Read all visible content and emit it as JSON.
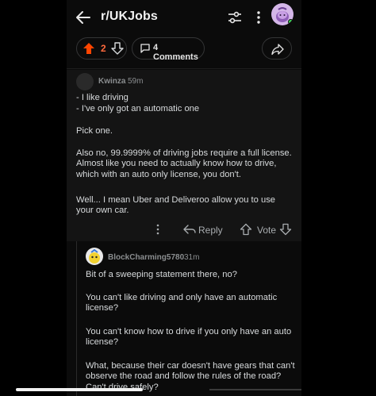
{
  "header": {
    "title": "r/UKJobs",
    "icons": {
      "back": "arrow-left-icon",
      "filter": "sliders-icon",
      "more": "more-vertical-icon"
    }
  },
  "actions": {
    "vote_count": "2",
    "comments_label": "4 Comments",
    "colors": {
      "upvoted": "#ff4500"
    }
  },
  "comment1": {
    "username": "Kwinza",
    "time": "59m",
    "lines": [
      "- I like driving",
      "- I've only got an automatic one"
    ],
    "paragraphs": [
      "Pick one.",
      "Also no, 99.9999% of driving jobs require a full license. Almost like you need to actually know how to drive, which with an auto only license, you don't.",
      "Well... I mean Uber and Deliveroo allow you to use your own car."
    ],
    "reply_label": "Reply",
    "vote_label": "Vote"
  },
  "comment2": {
    "username": "BlockCharming5780",
    "time": "31m",
    "paragraphs": [
      "Bit of a sweeping statement there, no?",
      "You can't like driving and only have an automatic license?",
      "You can't know how to drive if you only have an auto license?",
      "What, because their car doesn't have gears that can't observe the road and follow the rules of the road? Can't drive safely?"
    ]
  }
}
